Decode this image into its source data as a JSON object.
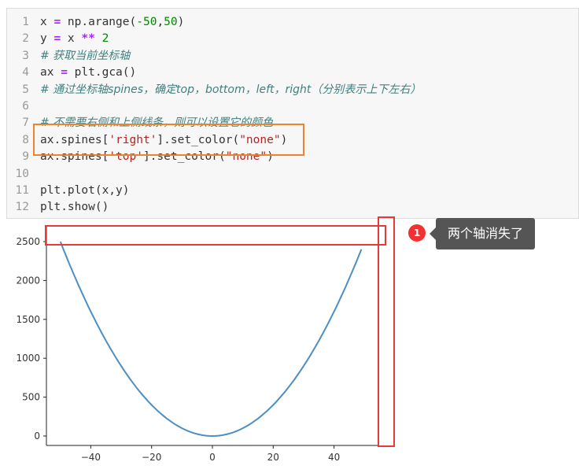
{
  "code_cell": {
    "lines": [
      {
        "n": "1",
        "parts": [
          {
            "t": "x ",
            "c": ""
          },
          {
            "t": "=",
            "c": "tok-op"
          },
          {
            "t": " np.arange(",
            "c": ""
          },
          {
            "t": "-50",
            "c": "tok-num"
          },
          {
            "t": ",",
            "c": ""
          },
          {
            "t": "50",
            "c": "tok-num"
          },
          {
            "t": ")",
            "c": ""
          }
        ]
      },
      {
        "n": "2",
        "parts": [
          {
            "t": "y ",
            "c": ""
          },
          {
            "t": "=",
            "c": "tok-op"
          },
          {
            "t": " x ",
            "c": ""
          },
          {
            "t": "**",
            "c": "tok-op"
          },
          {
            "t": " ",
            "c": ""
          },
          {
            "t": "2",
            "c": "tok-num"
          }
        ]
      },
      {
        "n": "3",
        "parts": [
          {
            "t": "# 获取当前坐标轴",
            "c": "tok-comment"
          }
        ]
      },
      {
        "n": "4",
        "parts": [
          {
            "t": "ax ",
            "c": ""
          },
          {
            "t": "=",
            "c": "tok-op"
          },
          {
            "t": " plt.gca()",
            "c": ""
          }
        ]
      },
      {
        "n": "5",
        "parts": [
          {
            "t": "# 通过坐标轴spines，确定top，bottom，left，right（分别表示上下左右）",
            "c": "tok-comment"
          }
        ]
      },
      {
        "n": "6",
        "parts": []
      },
      {
        "n": "7",
        "parts": [
          {
            "t": "# 不需要右侧和上侧线条，则可以设置它的颜色",
            "c": "tok-comment"
          }
        ]
      },
      {
        "n": "8",
        "parts": [
          {
            "t": "ax.spines[",
            "c": ""
          },
          {
            "t": "'right'",
            "c": "tok-str"
          },
          {
            "t": "].set_color(",
            "c": ""
          },
          {
            "t": "\"none\"",
            "c": "tok-str"
          },
          {
            "t": ")",
            "c": ""
          }
        ]
      },
      {
        "n": "9",
        "parts": [
          {
            "t": "ax.spines[",
            "c": ""
          },
          {
            "t": "'top'",
            "c": "tok-str"
          },
          {
            "t": "].set_color(",
            "c": ""
          },
          {
            "t": "\"none\"",
            "c": "tok-str"
          },
          {
            "t": ")",
            "c": ""
          }
        ]
      },
      {
        "n": "10",
        "parts": []
      },
      {
        "n": "11",
        "parts": [
          {
            "t": "plt.plot(x,y)",
            "c": ""
          }
        ]
      },
      {
        "n": "12",
        "parts": [
          {
            "t": "plt.show()",
            "c": ""
          }
        ]
      }
    ]
  },
  "annotation": {
    "badge_number": "1",
    "callout_text": "两个轴消失了",
    "colors": {
      "red_box": "#e5393c",
      "orange_box": "#f0842d",
      "callout_bg": "#555555"
    }
  },
  "chart_data": {
    "type": "line",
    "x_range": [
      -50,
      49
    ],
    "function": "y = x ** 2",
    "series": [
      {
        "color": "#4c8fc0"
      }
    ],
    "x_ticks": [
      -40,
      -20,
      0,
      20,
      40
    ],
    "y_ticks": [
      0,
      500,
      1000,
      1500,
      2000,
      2500
    ],
    "x_tick_labels": [
      "−40",
      "−20",
      "0",
      "20",
      "40"
    ],
    "y_tick_labels": [
      "0",
      "500",
      "1000",
      "1500",
      "2000",
      "2500"
    ],
    "visible_spines": [
      "left",
      "bottom"
    ]
  }
}
